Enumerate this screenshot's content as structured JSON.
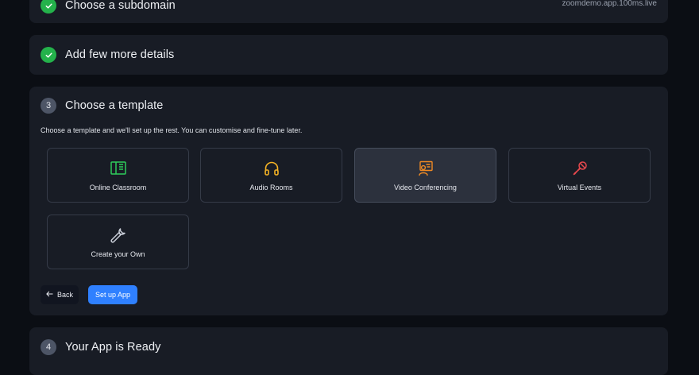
{
  "steps": [
    {
      "title": "Choose a subdomain",
      "status": "done",
      "value": "zoomdemo.app.100ms.live"
    },
    {
      "title": "Add few more details",
      "status": "done"
    },
    {
      "number": "3",
      "title": "Choose a template",
      "status": "active",
      "description": "Choose a template and we'll set up the rest. You can customise and fine-tune later."
    },
    {
      "number": "4",
      "title": "Your App is Ready",
      "status": "pending"
    }
  ],
  "templates": [
    {
      "label": "Online Classroom",
      "icon": "book-icon",
      "color": "#2ecc5b",
      "selected": false
    },
    {
      "label": "Audio Rooms",
      "icon": "headphones-icon",
      "color": "#f5b324",
      "selected": false
    },
    {
      "label": "Video Conferencing",
      "icon": "presenter-icon",
      "color": "#f08a24",
      "selected": true
    },
    {
      "label": "Virtual Events",
      "icon": "microphone-icon",
      "color": "#e5484d",
      "selected": false
    },
    {
      "label": "Create your Own",
      "icon": "wrench-icon",
      "color": "#c9ced8",
      "selected": false
    }
  ],
  "actions": {
    "back_label": "Back",
    "setup_label": "Set up App"
  }
}
